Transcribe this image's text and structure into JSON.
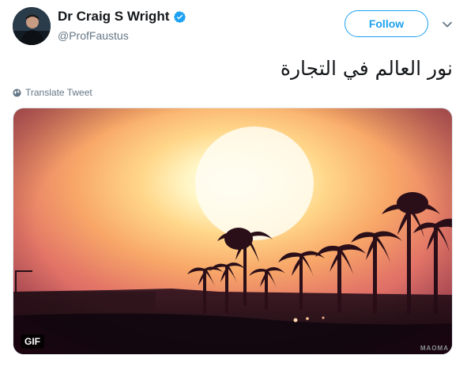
{
  "author": {
    "display_name": "Dr Craig S Wright",
    "handle": "@ProfFaustus",
    "verified": true
  },
  "actions": {
    "follow_label": "Follow",
    "more_icon": "chevron-down-icon"
  },
  "tweet": {
    "text": "نور العالم في التجارة",
    "translate_label": "Translate Tweet"
  },
  "media": {
    "badge": "GIF",
    "watermark": "MAOMA",
    "description_icon": "sunset-palm-trees-gif"
  },
  "colors": {
    "accent": "#1da1f2",
    "secondary_text": "#657786",
    "primary_text": "#14171a"
  }
}
